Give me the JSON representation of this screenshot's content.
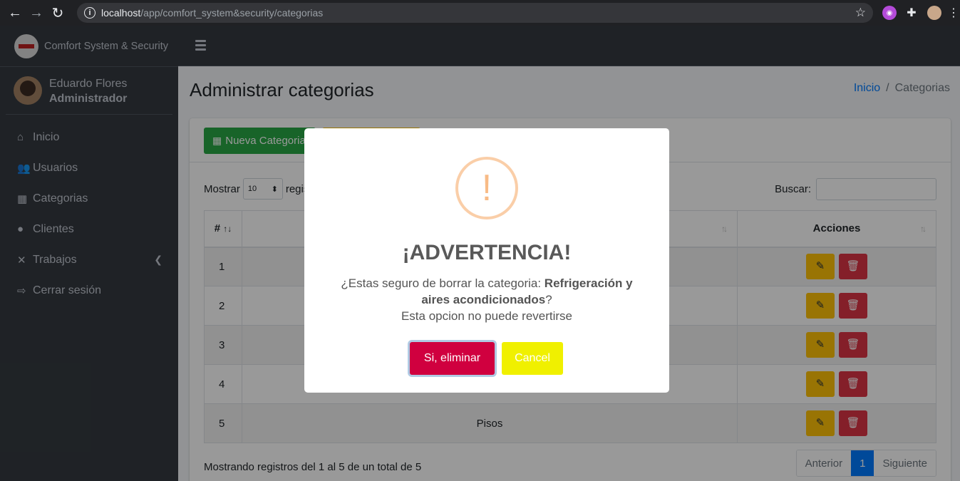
{
  "browser": {
    "url_host": "localhost",
    "url_path": "/app/comfort_system&security/categorias"
  },
  "brand": {
    "name": "Comfort System & Security"
  },
  "user": {
    "name": "Eduardo Flores",
    "role": "Administrador"
  },
  "menu": [
    {
      "label": "Inicio",
      "icon": "home-icon"
    },
    {
      "label": "Usuarios",
      "icon": "users-icon"
    },
    {
      "label": "Categorias",
      "icon": "boxes-icon"
    },
    {
      "label": "Clientes",
      "icon": "user-icon"
    },
    {
      "label": "Trabajos",
      "icon": "tools-icon"
    },
    {
      "label": "Cerrar sesión",
      "icon": "sign-out-icon"
    }
  ],
  "page": {
    "title": "Administrar categorias"
  },
  "breadcrumb": {
    "home": "Inicio",
    "current": "Categorias"
  },
  "toolbar": {
    "new_label": "Nueva Categoria"
  },
  "table_controls": {
    "show_label": "Mostrar",
    "length_value": "10",
    "length_suffix": "regis",
    "search_label": "Buscar:"
  },
  "table": {
    "headers": {
      "num": "#",
      "actions": "Acciones"
    },
    "rows": [
      {
        "num": "1",
        "name": ""
      },
      {
        "num": "2",
        "name": ""
      },
      {
        "num": "3",
        "name": ""
      },
      {
        "num": "4",
        "name": ""
      },
      {
        "num": "5",
        "name": "Pisos"
      }
    ]
  },
  "footer": {
    "info": "Mostrando registros del 1 al 5 de un total de 5",
    "prev": "Anterior",
    "page": "1",
    "next": "Siguiente"
  },
  "modal": {
    "icon_glyph": "!",
    "title": "¡ADVERTENCIA!",
    "text_prefix": "¿Estas seguro de borrar la categoria: ",
    "category": "Refrigeración y aires acondicionados",
    "text_suffix": "?",
    "warning": "Esta opcion no puede revertirse",
    "confirm_label": "Si, eliminar",
    "cancel_label": "Cancel"
  },
  "colors": {
    "sidebar": "#343a40",
    "success": "#28a745",
    "warning": "#ffc107",
    "danger": "#dc3545",
    "primary": "#007bff",
    "confirm": "#d0003f",
    "cancel": "#f0f000"
  }
}
